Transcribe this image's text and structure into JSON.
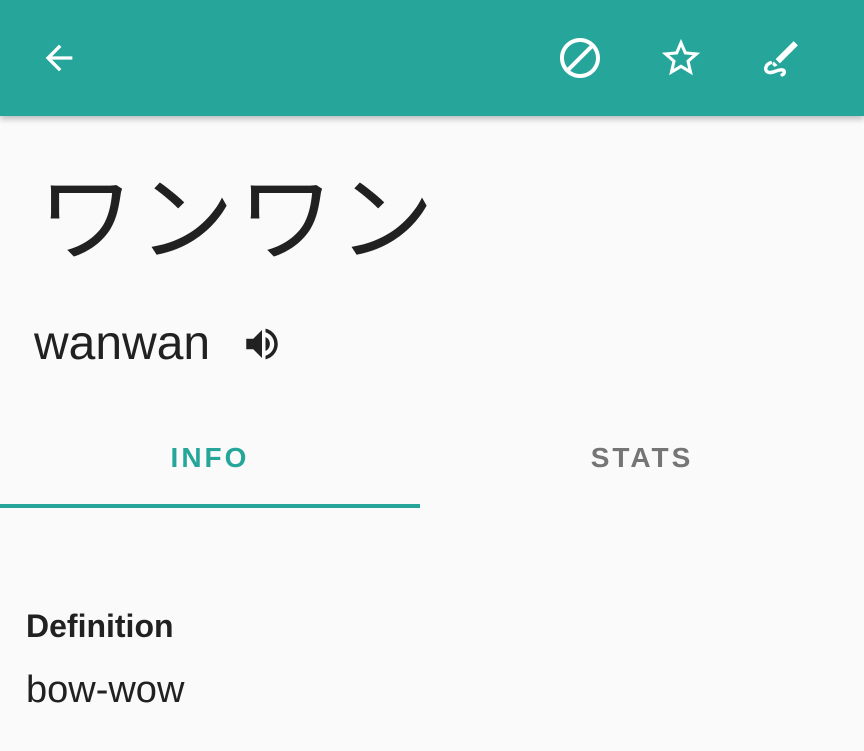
{
  "colors": {
    "toolbar_bg": "#26a69a",
    "accent": "#26a69a",
    "text_primary": "#212121",
    "text_secondary": "#757575",
    "background": "#fafafa"
  },
  "toolbar": {
    "back_icon": "arrow-back-icon",
    "actions": [
      {
        "icon": "block-icon"
      },
      {
        "icon": "star-outline-icon"
      },
      {
        "icon": "edit-brush-icon"
      }
    ]
  },
  "word": {
    "kana": "ワンワン",
    "romaji": "wanwan",
    "audio_icon": "volume-up-icon"
  },
  "tabs": [
    {
      "label": "INFO",
      "active": true
    },
    {
      "label": "STATS",
      "active": false
    }
  ],
  "info": {
    "definition_label": "Definition",
    "definition_value": "bow-wow"
  }
}
